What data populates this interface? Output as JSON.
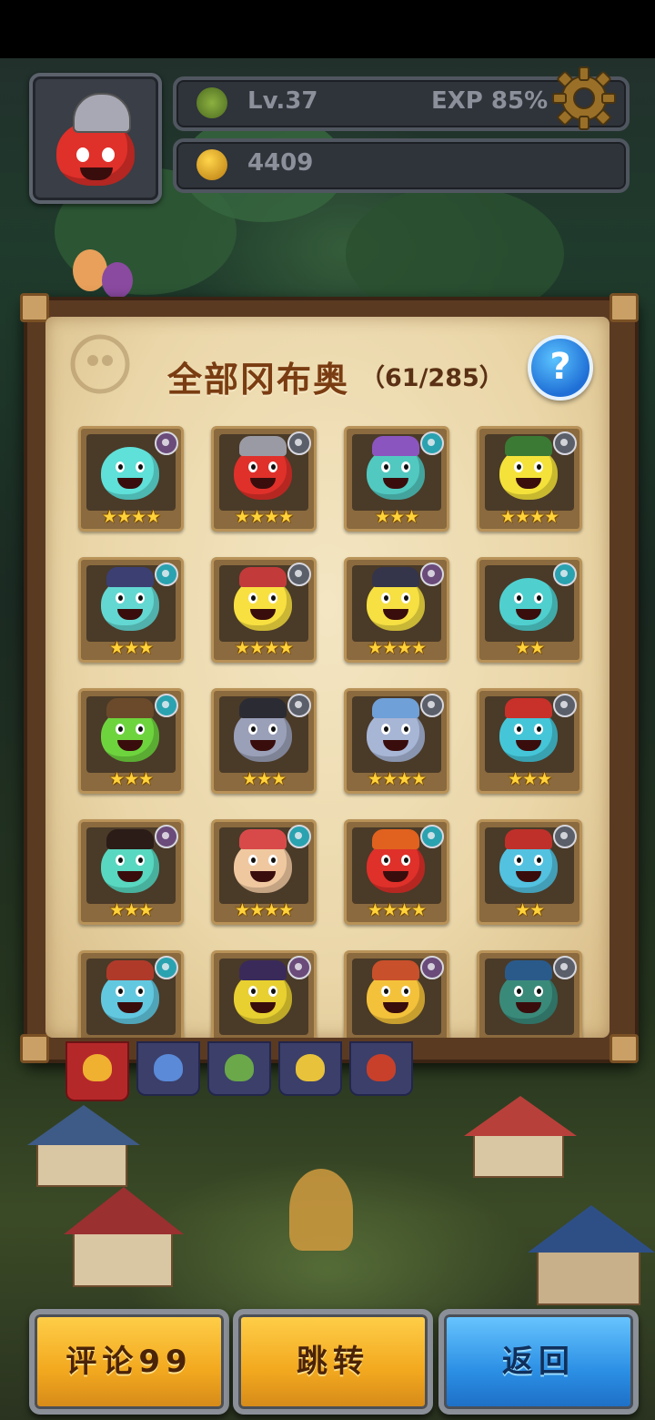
{
  "hud": {
    "level": "Lv.37",
    "exp": "EXP 85%",
    "currency": "4409",
    "icons": {
      "level": "clover-icon",
      "currency": "gold-fruit-icon",
      "settings": "gear-icon"
    }
  },
  "panel": {
    "title": "全部冈布奥",
    "count": "（61/285）",
    "help_label": "?"
  },
  "cards": [
    {
      "stars": "★★★★",
      "color": "#5fe0d8",
      "hat": "",
      "badge": "staff"
    },
    {
      "stars": "★★★★",
      "color": "#e0302a",
      "hat": "#9a9aa4",
      "badge": "sword"
    },
    {
      "stars": "★★★",
      "color": "#52c9c0",
      "hat": "#8b55c0",
      "badge": "swirl"
    },
    {
      "stars": "★★★★",
      "color": "#f4e23a",
      "hat": "#3a7a34",
      "badge": "sword"
    },
    {
      "stars": "★★★",
      "color": "#63d8d2",
      "hat": "#3b3f72",
      "badge": "swirl"
    },
    {
      "stars": "★★★★",
      "color": "#f8e040",
      "hat": "#c23a3a",
      "badge": "sword"
    },
    {
      "stars": "★★★★",
      "color": "#f6e042",
      "hat": "#34344a",
      "badge": "staff"
    },
    {
      "stars": "★★",
      "color": "#4fd0cf",
      "hat": "",
      "badge": "swirl"
    },
    {
      "stars": "★★★",
      "color": "#6ed43e",
      "hat": "#6a4a2a",
      "badge": "swirl"
    },
    {
      "stars": "★★★",
      "color": "#9aa0b8",
      "hat": "#2b2b33",
      "badge": "sword"
    },
    {
      "stars": "★★★★",
      "color": "#a8b6d6",
      "hat": "#6fa0d8",
      "badge": "sword"
    },
    {
      "stars": "★★★",
      "color": "#45c6d8",
      "hat": "#c8302a",
      "badge": "sword"
    },
    {
      "stars": "★★★",
      "color": "#58d8c0",
      "hat": "#2b1c18",
      "badge": "staff"
    },
    {
      "stars": "★★★★",
      "color": "#f0c8a0",
      "hat": "#d84a4a",
      "badge": "swirl"
    },
    {
      "stars": "★★★★",
      "color": "#e0302a",
      "hat": "#e0621e",
      "badge": "swirl"
    },
    {
      "stars": "★★",
      "color": "#52c2e0",
      "hat": "#c0302a",
      "badge": "sword"
    },
    {
      "stars": "",
      "color": "#62c8e0",
      "hat": "#b03a2a",
      "badge": "swirl"
    },
    {
      "stars": "",
      "color": "#e8d030",
      "hat": "#3a2a5a",
      "badge": "staff"
    },
    {
      "stars": "",
      "color": "#f4c23a",
      "hat": "#c8502a",
      "badge": "staff"
    },
    {
      "stars": "",
      "color": "#3a8a7a",
      "hat": "#2a5a8a",
      "badge": "sword"
    }
  ],
  "tabs": [
    {
      "name": "tab-all",
      "color": "#f0b030"
    },
    {
      "name": "tab-blue",
      "color": "#5a8ad8"
    },
    {
      "name": "tab-green",
      "color": "#6aa84a"
    },
    {
      "name": "tab-yellow",
      "color": "#e8c23a"
    },
    {
      "name": "tab-red",
      "color": "#c8402a"
    }
  ],
  "buttons": {
    "comment": "评论99",
    "jump": "跳转",
    "back": "返回"
  }
}
